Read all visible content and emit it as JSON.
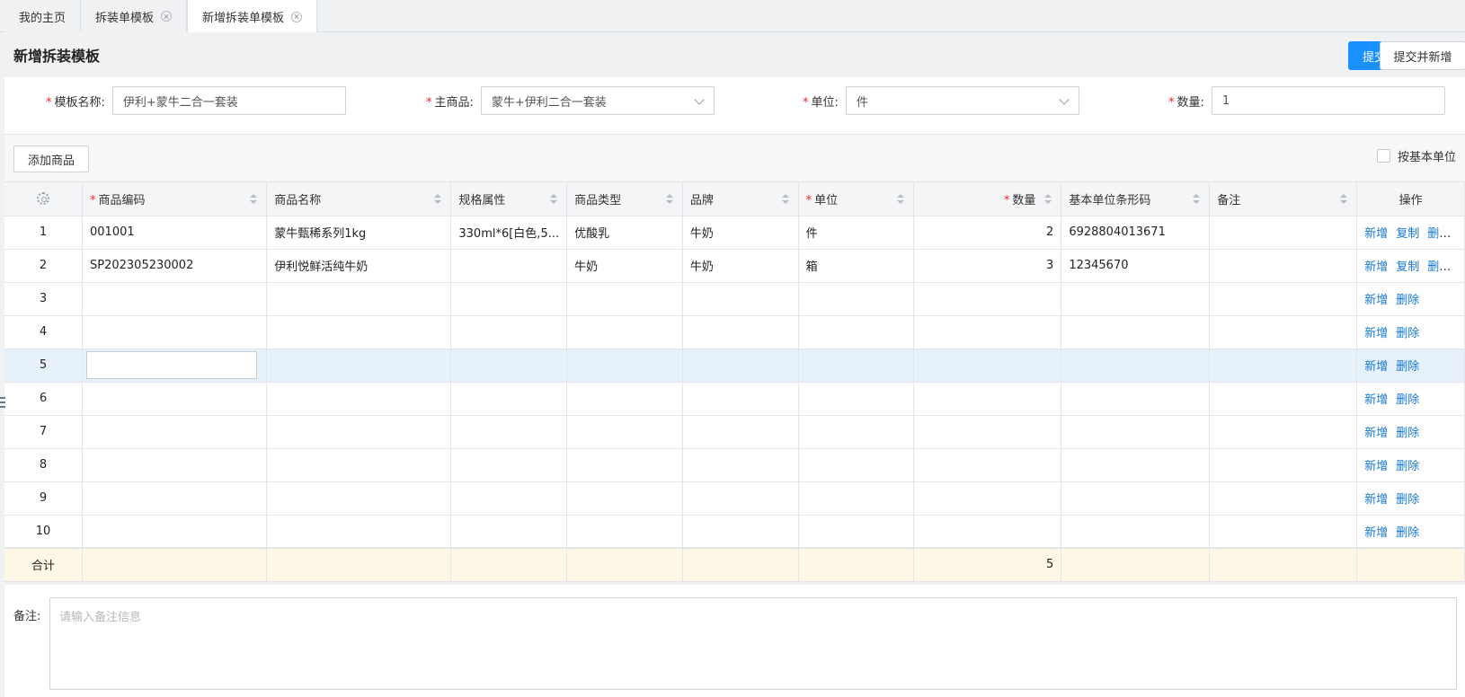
{
  "tabs": [
    {
      "label": "我的主页"
    },
    {
      "label": "拆装单模板"
    },
    {
      "label": "新增拆装单模板"
    }
  ],
  "header": {
    "title": "新增拆装模板",
    "submit_label": "提交",
    "submit_new_label": "提交并新增"
  },
  "form": {
    "name_label": "模板名称:",
    "name_value": "伊利+蒙牛二合一套装",
    "main_label": "主商品:",
    "main_value": "蒙牛+伊利二合一套装",
    "unit_label": "单位:",
    "unit_value": "件",
    "qty_label": "数量:",
    "qty_value": "1",
    "required_mark": "*"
  },
  "toolbar": {
    "add_label": "添加商品",
    "base_unit_label": "按基本单位"
  },
  "table": {
    "headers": {
      "code": "商品编码",
      "name": "商品名称",
      "spec": "规格属性",
      "type": "商品类型",
      "brand": "品牌",
      "unit": "单位",
      "qty": "数量",
      "barcode": "基本单位条形码",
      "remark": "备注",
      "ops": "操作"
    },
    "rows": [
      {
        "idx": "1",
        "code": "001001",
        "name": "蒙牛甄稀系列1kg",
        "spec": "330ml*6[白色,5...",
        "type": "优酸乳",
        "brand": "牛奶",
        "unit": "件",
        "qty": "2",
        "barcode": "6928804013671",
        "remark": ""
      },
      {
        "idx": "2",
        "code": "SP202305230002",
        "name": "伊利悦鲜活纯牛奶",
        "spec": "",
        "type": "牛奶",
        "brand": "牛奶",
        "unit": "箱",
        "qty": "3",
        "barcode": "12345670",
        "remark": ""
      },
      {
        "idx": "3"
      },
      {
        "idx": "4"
      },
      {
        "idx": "5"
      },
      {
        "idx": "6"
      },
      {
        "idx": "7"
      },
      {
        "idx": "8"
      },
      {
        "idx": "9"
      },
      {
        "idx": "10"
      }
    ],
    "ops": {
      "add": "新增",
      "copy": "复制",
      "delete": "删除"
    },
    "total_label": "合计",
    "total_qty": "5"
  },
  "remark": {
    "label": "备注:",
    "placeholder": "请输入备注信息"
  }
}
